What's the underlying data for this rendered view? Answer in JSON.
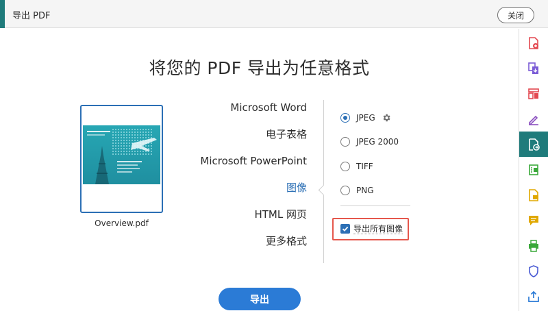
{
  "header": {
    "title": "导出 PDF",
    "close_label": "关闭"
  },
  "main": {
    "heading": "将您的 PDF 导出为任意格式",
    "file": {
      "name": "Overview.pdf"
    },
    "formats": [
      {
        "label": "Microsoft Word",
        "active": false
      },
      {
        "label": "电子表格",
        "active": false
      },
      {
        "label": "Microsoft PowerPoint",
        "active": false
      },
      {
        "label": "图像",
        "active": true
      },
      {
        "label": "HTML 网页",
        "active": false
      },
      {
        "label": "更多格式",
        "active": false
      }
    ],
    "image_options": [
      {
        "label": "JPEG",
        "selected": true
      },
      {
        "label": "JPEG 2000",
        "selected": false
      },
      {
        "label": "TIFF",
        "selected": false
      },
      {
        "label": "PNG",
        "selected": false
      }
    ],
    "export_all_images": {
      "label": "导出所有图像",
      "checked": true
    },
    "export_button": "导出"
  },
  "sidebar": {
    "tools": [
      {
        "icon": "create-pdf-icon",
        "color": "#e34850",
        "active": false
      },
      {
        "icon": "combine-files-icon",
        "color": "#7b5cd6",
        "active": false
      },
      {
        "icon": "organize-pages-icon",
        "color": "#e34850",
        "active": false
      },
      {
        "icon": "fill-sign-icon",
        "color": "#8a4fbf",
        "active": false
      },
      {
        "icon": "export-pdf-icon",
        "color": "#ffffff",
        "active": true
      },
      {
        "icon": "edit-pdf-icon",
        "color": "#3aa83a",
        "active": false
      },
      {
        "icon": "comment-file-icon",
        "color": "#e0a800",
        "active": false
      },
      {
        "icon": "comment-icon",
        "color": "#e0a800",
        "active": false
      },
      {
        "icon": "print-production-icon",
        "color": "#3aa83a",
        "active": false
      },
      {
        "icon": "protect-icon",
        "color": "#4a5bd4",
        "active": false
      },
      {
        "icon": "share-icon",
        "color": "#2b7bd6",
        "active": false
      }
    ]
  },
  "colors": {
    "accent": "#1f7b7b",
    "link": "#2b6fb5",
    "button": "#2b7bd6",
    "highlight": "#e5574c"
  }
}
